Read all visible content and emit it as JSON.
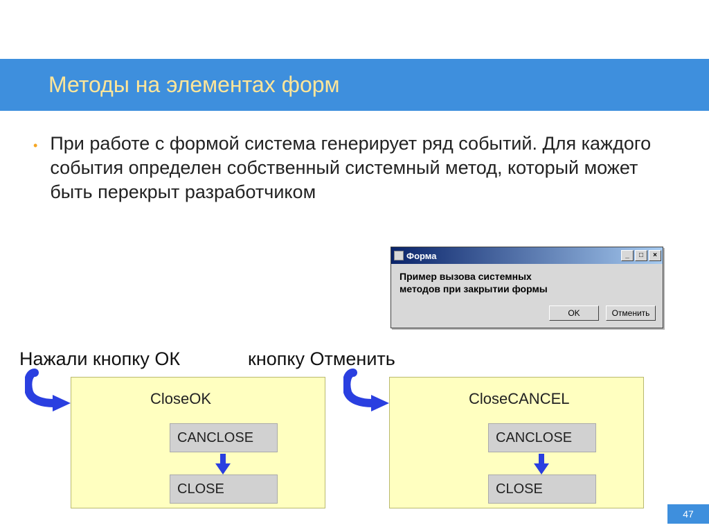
{
  "title": "Методы на элементах форм",
  "bullet": "При работе с формой система генерирует ряд событий. Для каждого события определен собственный системный метод, который может быть перекрыт разработчиком",
  "dialog": {
    "title": "Форма",
    "line1": "Пример вызова системных",
    "line2": "методов при закрытии формы",
    "ok": "OK",
    "cancel": "Отменить"
  },
  "flow": {
    "label_ok": "Нажали кнопку ОК",
    "label_cancel": "кнопку Отменить",
    "ok_first": "CloseOK",
    "cancel_first": "CloseCANCEL",
    "step1": "CANCLOSE",
    "step2": "CLOSE"
  },
  "page_number": "47"
}
